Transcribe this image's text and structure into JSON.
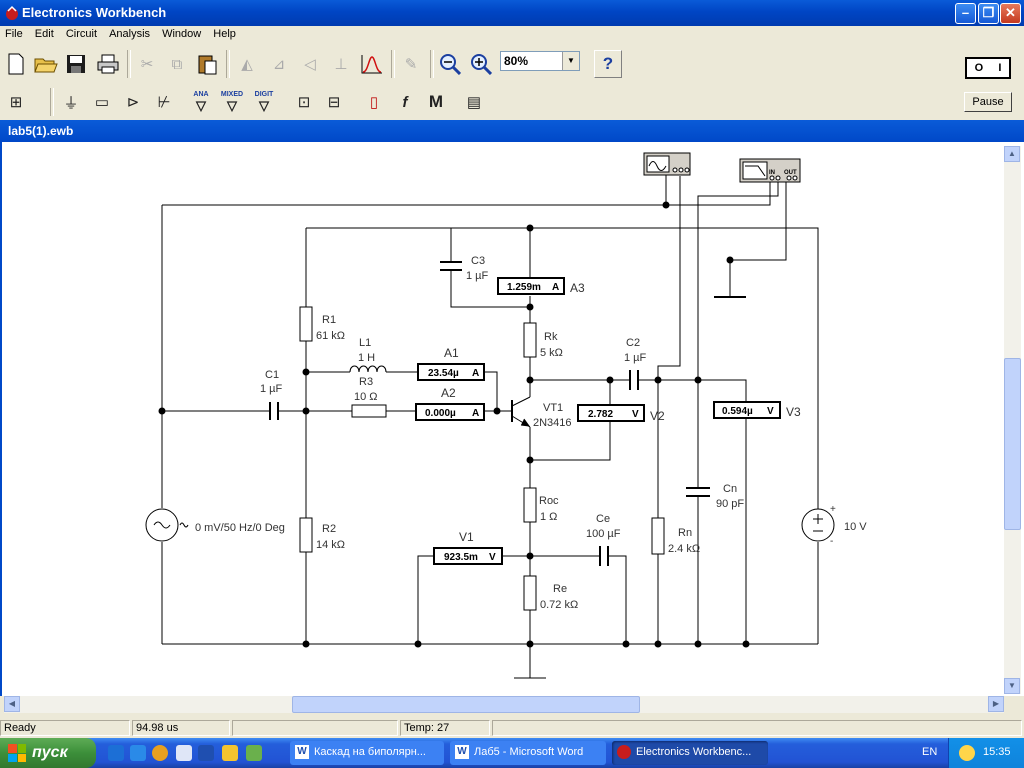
{
  "window": {
    "title": "Electronics Workbench"
  },
  "menu": [
    {
      "id": "menu-file",
      "label": "File"
    },
    {
      "id": "menu-edit",
      "label": "Edit"
    },
    {
      "id": "menu-circuit",
      "label": "Circuit"
    },
    {
      "id": "menu-analysis",
      "label": "Analysis"
    },
    {
      "id": "menu-window",
      "label": "Window"
    },
    {
      "id": "menu-help",
      "label": "Help"
    }
  ],
  "toolbar": {
    "zoom": "80%",
    "help_label": "?",
    "pause_label": "Pause",
    "bins": [
      {
        "label": "ANA"
      },
      {
        "label": "MIXED"
      },
      {
        "label": "DIGIT"
      }
    ],
    "icons": [
      "new-icon",
      "open-icon",
      "save-icon",
      "print-icon",
      "cut-icon",
      "copy-icon",
      "paste-icon",
      "rotate-icon",
      "flip-horizontal-icon",
      "flip-vertical-icon",
      "subcircuit-icon",
      "graph-icon",
      "component-properties-icon",
      "zoom-out-icon",
      "zoom-in-icon"
    ]
  },
  "document": {
    "title": "lab5(1).ewb"
  },
  "circuit": {
    "components": {
      "R1": {
        "name": "R1",
        "value": "61 kΩ"
      },
      "C1": {
        "name": "C1",
        "value": "1 µF"
      },
      "L1": {
        "name": "L1",
        "value": "1 H"
      },
      "R3": {
        "name": "R3",
        "value": "10 Ω"
      },
      "C3": {
        "name": "C3",
        "value": "1 µF"
      },
      "Rk": {
        "name": "Rk",
        "value": "5 kΩ"
      },
      "C2": {
        "name": "C2",
        "value": "1 µF"
      },
      "VT1": {
        "name": "VT1",
        "value": "2N3416"
      },
      "R2": {
        "name": "R2",
        "value": "14 kΩ"
      },
      "Roc": {
        "name": "Roc",
        "value": "1 Ω"
      },
      "Ce": {
        "name": "Ce",
        "value": "100 µF"
      },
      "Re": {
        "name": "Re",
        "value": "0.72 kΩ"
      },
      "Rn": {
        "name": "Rn",
        "value": "2.4 kΩ"
      },
      "Cn": {
        "name": "Cn",
        "value": "90 pF"
      },
      "source": {
        "value": "0 mV/50 Hz/0 Deg"
      },
      "battery": {
        "value": "10 V",
        "plus": "+",
        "minus": "-"
      }
    },
    "meters": {
      "A1": {
        "name": "A1",
        "reading": "23.54µ",
        "unit": "A"
      },
      "A2": {
        "name": "A2",
        "reading": "0.000µ",
        "unit": "A"
      },
      "A3": {
        "name": "A3",
        "reading": "1.259m",
        "unit": "A"
      },
      "V1": {
        "name": "V1",
        "reading": "923.5m",
        "unit": "V"
      },
      "V2": {
        "name": "V2",
        "reading": "2.782",
        "unit": "V"
      },
      "V3": {
        "name": "V3",
        "reading": "0.594µ",
        "unit": "V"
      }
    },
    "bode": {
      "in_label": "IN",
      "out_label": "OUT"
    }
  },
  "status": {
    "state": "Ready",
    "time": "94.98 us",
    "temp_label": "Temp:",
    "temp_value": "27"
  },
  "taskbar": {
    "start_label": "пуск",
    "tasks": [
      {
        "label": "Каскад на биполярн..."
      },
      {
        "label": "Лаб5 - Microsoft Word"
      },
      {
        "label": "Electronics Workbenc..."
      }
    ],
    "lang": "EN",
    "clock": "15:35"
  }
}
